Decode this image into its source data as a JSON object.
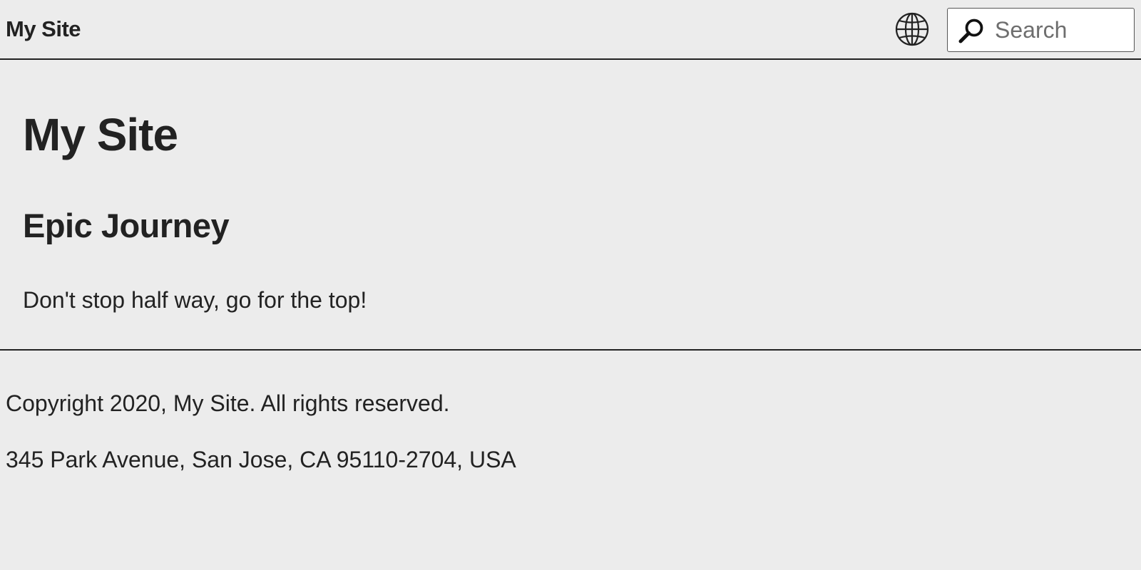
{
  "header": {
    "brand": "My Site",
    "language_icon": "globe-icon",
    "search": {
      "placeholder": "Search",
      "value": "",
      "icon": "search-icon"
    }
  },
  "main": {
    "title": "My Site",
    "section_title": "Epic Journey",
    "text": "Don't stop half way, go for the top!"
  },
  "footer": {
    "copyright": "Copyright 2020, My Site. All rights reserved.",
    "address": "345 Park Avenue, San Jose, CA 95110-2704, USA"
  },
  "colors": {
    "background": "#ececec",
    "text": "#222222",
    "divider": "#222222",
    "search_background": "#ffffff",
    "placeholder": "#6e6e6e"
  }
}
